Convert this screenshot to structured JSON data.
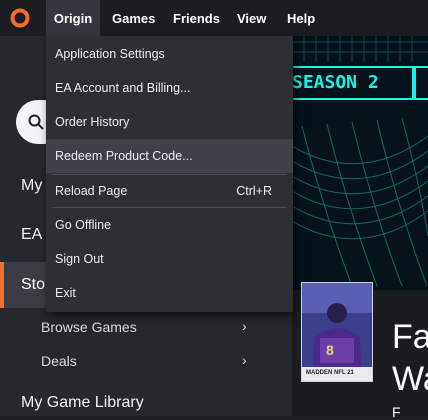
{
  "menubar": {
    "items": [
      {
        "label": "Origin"
      },
      {
        "label": "Games"
      },
      {
        "label": "Friends"
      },
      {
        "label": "View"
      },
      {
        "label": "Help"
      }
    ]
  },
  "banner": {
    "season_label": "SEASON 2"
  },
  "dropdown": {
    "items": [
      {
        "label": "Application Settings"
      },
      {
        "label": "EA Account and Billing..."
      },
      {
        "label": "Order History"
      },
      {
        "label": "Redeem Product Code..."
      },
      {
        "label": "Reload Page",
        "shortcut": "Ctrl+R"
      },
      {
        "label": "Go Offline"
      },
      {
        "label": "Sign Out"
      },
      {
        "label": "Exit"
      }
    ]
  },
  "sidebar": {
    "partial_items": [
      {
        "label": "My"
      },
      {
        "label": "EA P"
      },
      {
        "label": "Sto"
      }
    ],
    "sub_items": [
      {
        "label": "Browse Games"
      },
      {
        "label": "Deals"
      }
    ],
    "game_library": "My Game Library"
  },
  "promo": {
    "line1": "Fa",
    "line2": "Wa",
    "line3": "F"
  },
  "cover": {
    "brand": "MADDEN NFL 21"
  },
  "colors": {
    "accent": "#f56c2d",
    "banner_cyan": "#19f2e8",
    "menu_bg": "#2c2f34"
  }
}
